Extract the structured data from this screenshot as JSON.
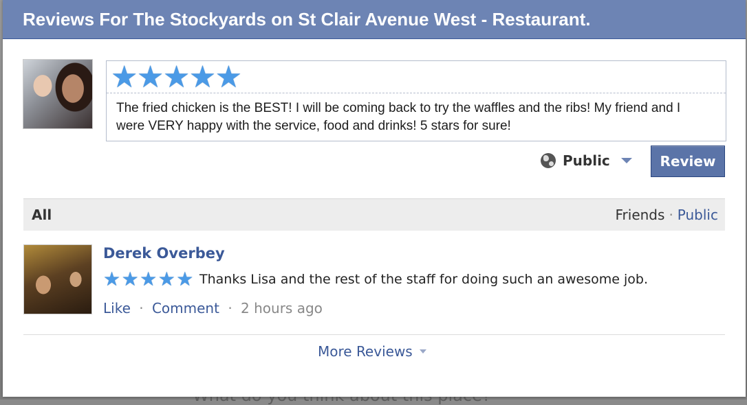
{
  "dialog": {
    "title": "Reviews For The Stockyards on St Clair Avenue West - Restaurant."
  },
  "composer": {
    "rating": 5,
    "stars": [
      "★",
      "★",
      "★",
      "★",
      "★"
    ],
    "text": "The fried chicken is the BEST! I will be coming back to try the waffles and the ribs! My friend and I were VERY happy with the service, food and drinks! 5 stars for sure!",
    "privacy_label": "Public",
    "privacy_icon": "globe-icon",
    "submit_label": "Review"
  },
  "filter": {
    "all_label": "All",
    "friends_label": "Friends",
    "separator": "·",
    "public_label": "Public"
  },
  "reviews": [
    {
      "name": "Derek Overbey",
      "rating": 5,
      "stars": [
        "★",
        "★",
        "★",
        "★",
        "★"
      ],
      "text": "Thanks Lisa and the rest of the staff for doing such an awesome job.",
      "like_label": "Like",
      "separator": "·",
      "comment_label": "Comment",
      "time": "2 hours ago"
    }
  ],
  "footer": {
    "more_label": "More Reviews"
  },
  "backdrop": {
    "text": "What do you think about this place?"
  },
  "colors": {
    "header": "#6d84b4",
    "link": "#3b5998",
    "star": "#4b9ae6",
    "button": "#5b74a8"
  }
}
